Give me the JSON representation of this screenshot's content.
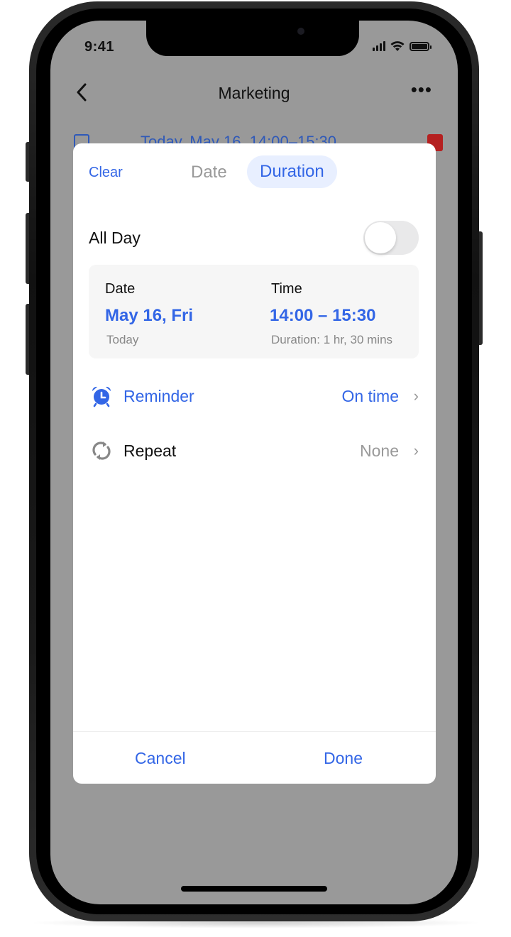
{
  "status_bar": {
    "time": "9:41"
  },
  "nav": {
    "back_glyph": "‹",
    "title": "Marketing",
    "more_glyph": "•••"
  },
  "background": {
    "event_date": "Today, May 16, 14:00–15:30"
  },
  "sheet": {
    "clear_label": "Clear",
    "tabs": [
      {
        "label": "Date",
        "selected": false
      },
      {
        "label": "Duration",
        "selected": true
      }
    ],
    "all_day": {
      "label": "All Day",
      "enabled": false
    },
    "date_time": {
      "date_label": "Date",
      "date_value": "May 16, Fri",
      "date_sub": "Today",
      "time_label": "Time",
      "time_value": "14:00 – 15:30",
      "time_sub": "Duration: 1 hr, 30 mins"
    },
    "reminder": {
      "label": "Reminder",
      "value": "On time",
      "chevron": "›"
    },
    "repeat": {
      "label": "Repeat",
      "value": "None",
      "chevron": "›"
    },
    "cancel_label": "Cancel",
    "done_label": "Done"
  },
  "colors": {
    "accent": "#3366e6",
    "accent_light": "#e8efff",
    "dimmed_background": "#999999",
    "secondary_text": "#999999"
  },
  "icons": {
    "reminder": "alarm-clock-icon",
    "repeat": "repeat-icon"
  }
}
